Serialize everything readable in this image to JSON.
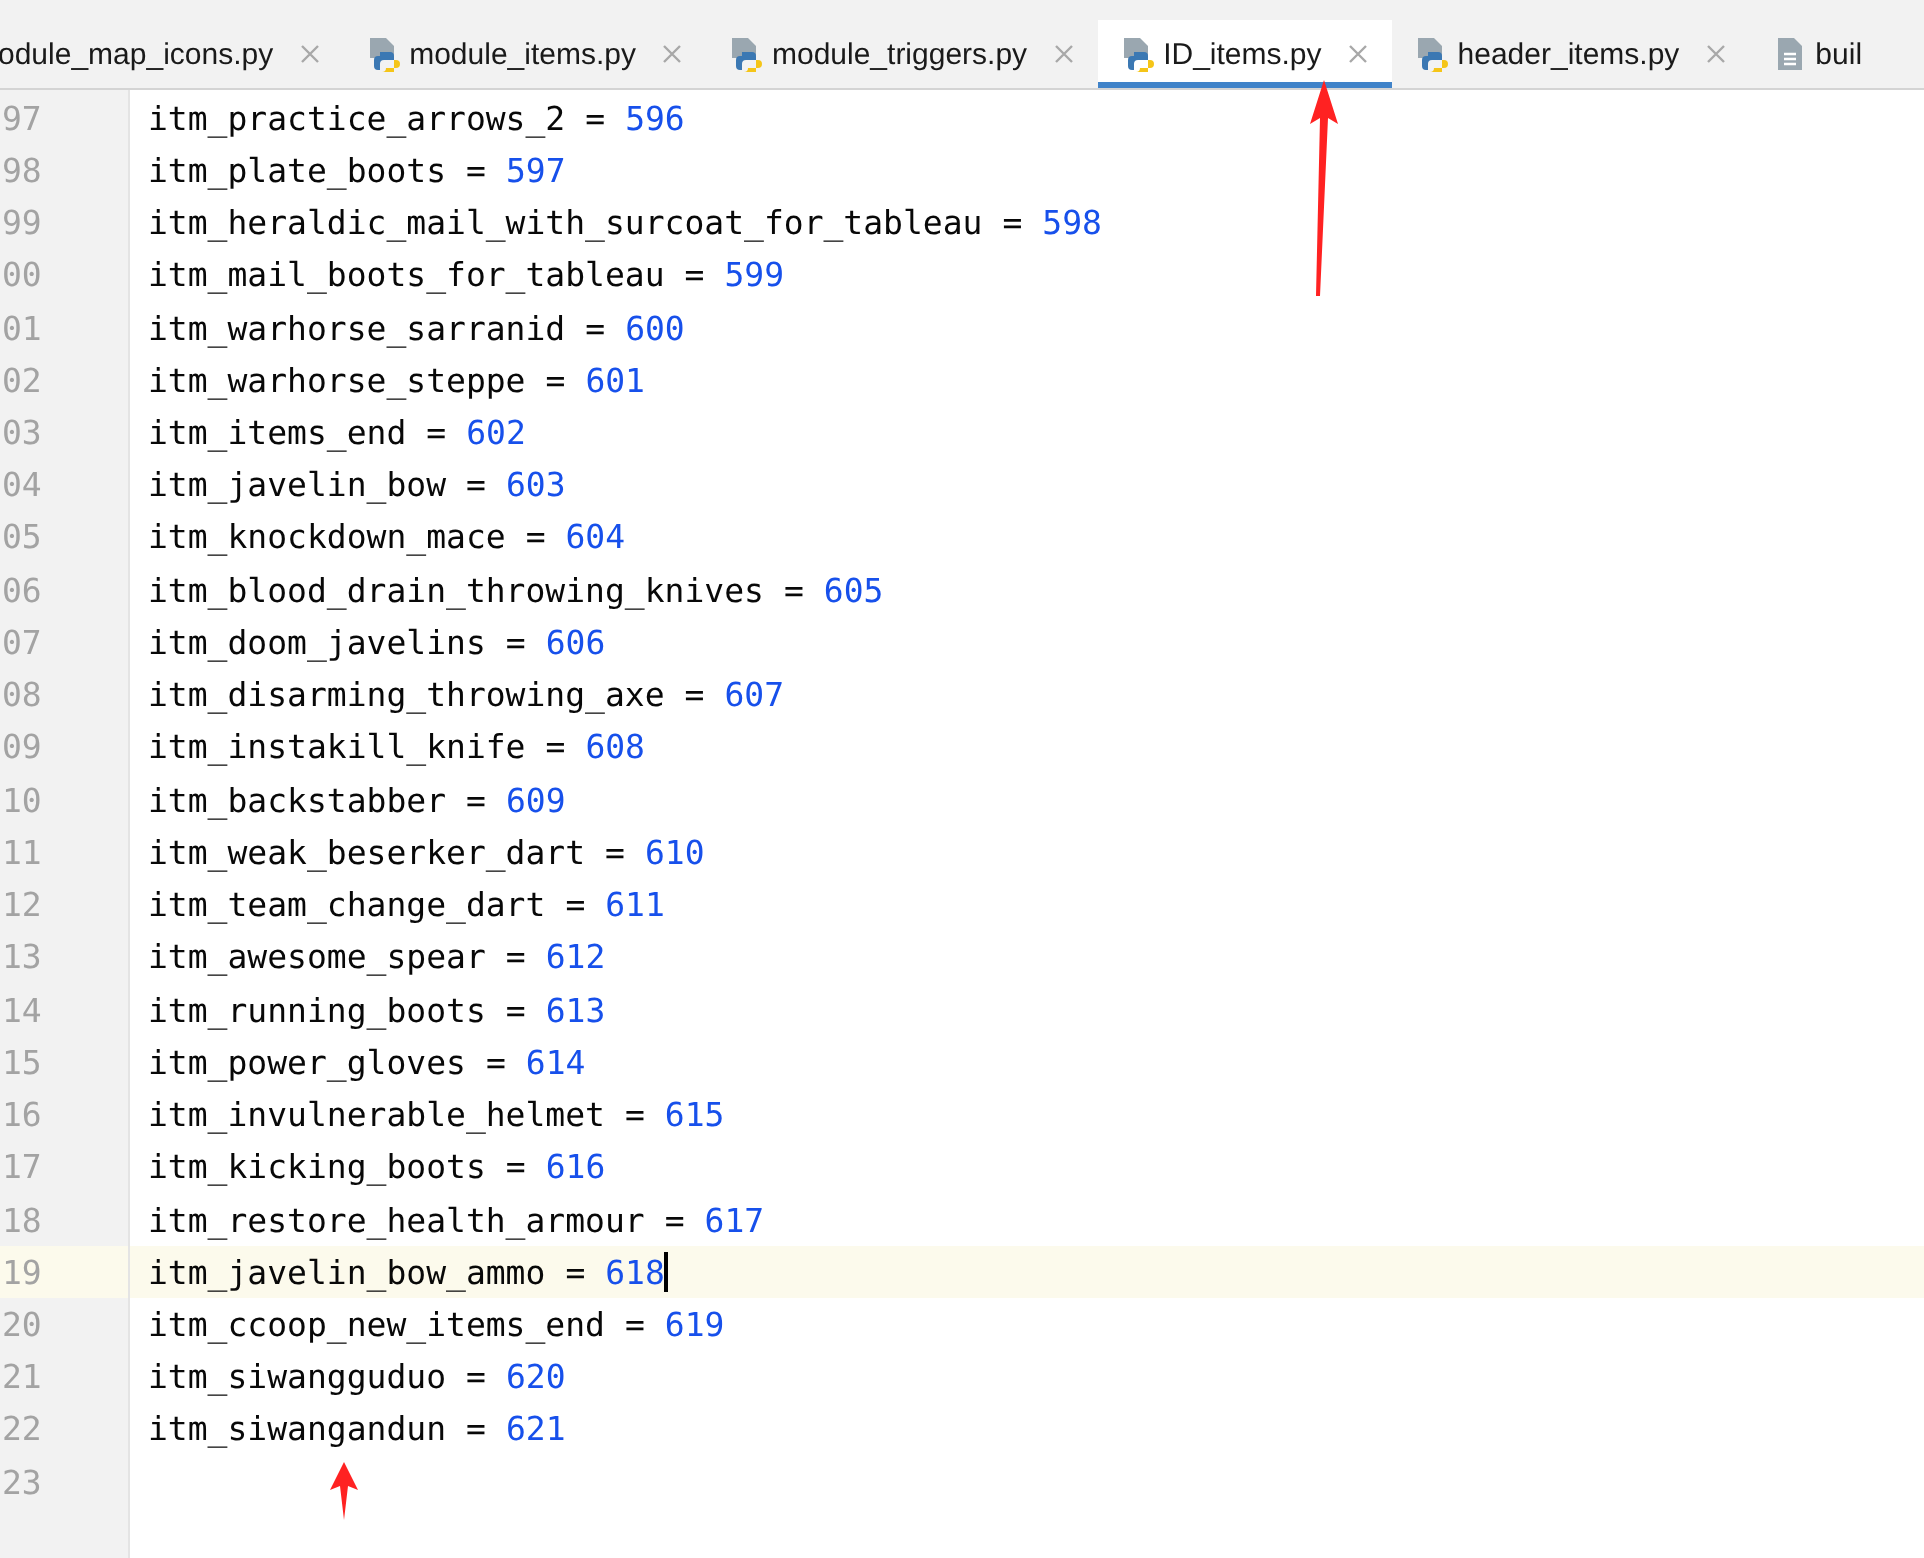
{
  "tabs": [
    {
      "label": "odule_map_icons.py",
      "kind": "cut",
      "selected": false
    },
    {
      "label": "module_items.py",
      "kind": "python",
      "selected": false
    },
    {
      "label": "module_triggers.py",
      "kind": "python",
      "selected": false
    },
    {
      "label": "ID_items.py",
      "kind": "python",
      "selected": true
    },
    {
      "label": "header_items.py",
      "kind": "python",
      "selected": false
    },
    {
      "label": "buil",
      "kind": "text",
      "selected": false
    }
  ],
  "editor": {
    "lines": [
      {
        "number": "97",
        "name": "itm_practice_arrows_2",
        "operator": "=",
        "value": "596",
        "current": false
      },
      {
        "number": "98",
        "name": "itm_plate_boots",
        "operator": "=",
        "value": "597",
        "current": false
      },
      {
        "number": "99",
        "name": "itm_heraldic_mail_with_surcoat_for_tableau",
        "operator": "=",
        "value": "598",
        "current": false
      },
      {
        "number": "00",
        "name": "itm_mail_boots_for_tableau",
        "operator": "=",
        "value": "599",
        "current": false
      },
      {
        "number": "01",
        "name": "itm_warhorse_sarranid",
        "operator": "=",
        "value": "600",
        "current": false
      },
      {
        "number": "02",
        "name": "itm_warhorse_steppe",
        "operator": "=",
        "value": "601",
        "current": false
      },
      {
        "number": "03",
        "name": "itm_items_end",
        "operator": "=",
        "value": "602",
        "current": false
      },
      {
        "number": "04",
        "name": "itm_javelin_bow",
        "operator": "=",
        "value": "603",
        "current": false
      },
      {
        "number": "05",
        "name": "itm_knockdown_mace",
        "operator": "=",
        "value": "604",
        "current": false
      },
      {
        "number": "06",
        "name": "itm_blood_drain_throwing_knives",
        "operator": "=",
        "value": "605",
        "current": false
      },
      {
        "number": "07",
        "name": "itm_doom_javelins",
        "operator": "=",
        "value": "606",
        "current": false
      },
      {
        "number": "08",
        "name": "itm_disarming_throwing_axe",
        "operator": "=",
        "value": "607",
        "current": false
      },
      {
        "number": "09",
        "name": "itm_instakill_knife",
        "operator": "=",
        "value": "608",
        "current": false
      },
      {
        "number": "10",
        "name": "itm_backstabber",
        "operator": "=",
        "value": "609",
        "current": false
      },
      {
        "number": "11",
        "name": "itm_weak_beserker_dart",
        "operator": "=",
        "value": "610",
        "current": false
      },
      {
        "number": "12",
        "name": "itm_team_change_dart",
        "operator": "=",
        "value": "611",
        "current": false
      },
      {
        "number": "13",
        "name": "itm_awesome_spear",
        "operator": "=",
        "value": "612",
        "current": false
      },
      {
        "number": "14",
        "name": "itm_running_boots",
        "operator": "=",
        "value": "613",
        "current": false
      },
      {
        "number": "15",
        "name": "itm_power_gloves",
        "operator": "=",
        "value": "614",
        "current": false
      },
      {
        "number": "16",
        "name": "itm_invulnerable_helmet",
        "operator": "=",
        "value": "615",
        "current": false
      },
      {
        "number": "17",
        "name": "itm_kicking_boots",
        "operator": "=",
        "value": "616",
        "current": false
      },
      {
        "number": "18",
        "name": "itm_restore_health_armour",
        "operator": "=",
        "value": "617",
        "current": false
      },
      {
        "number": "19",
        "name": "itm_javelin_bow_ammo",
        "operator": "=",
        "value": "618",
        "current": true
      },
      {
        "number": "20",
        "name": "itm_ccoop_new_items_end",
        "operator": "=",
        "value": "619",
        "current": false
      },
      {
        "number": "21",
        "name": "itm_siwangguduo",
        "operator": "=",
        "value": "620",
        "current": false
      },
      {
        "number": "22",
        "name": "itm_siwangandun",
        "operator": "=",
        "value": "621",
        "current": false
      },
      {
        "number": "23",
        "current": false
      }
    ]
  }
}
